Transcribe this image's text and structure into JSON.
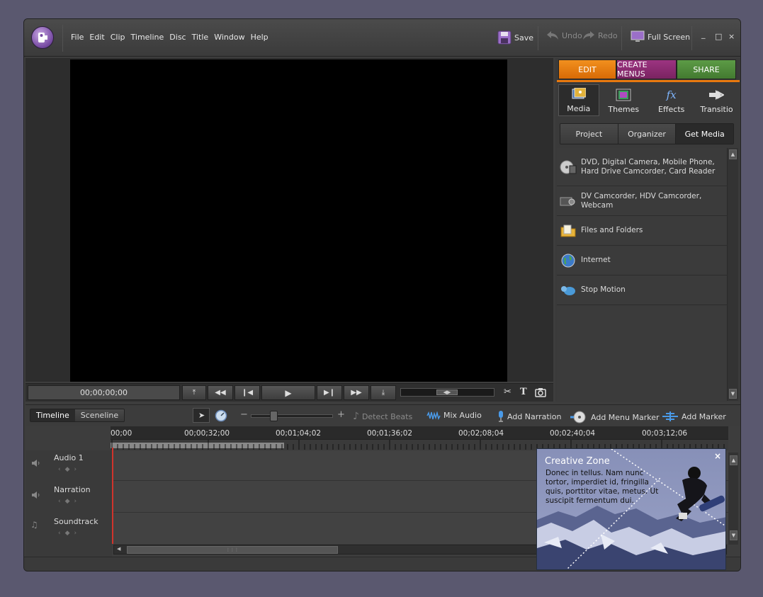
{
  "menu": [
    "File",
    "Edit",
    "Clip",
    "Timeline",
    "Disc",
    "Title",
    "Window",
    "Help"
  ],
  "toolbar": {
    "save": "Save",
    "undo": "Undo",
    "redo": "Redo",
    "fullscreen": "Full Screen"
  },
  "window": {
    "minimize": "_",
    "maximize": "□",
    "close": "×"
  },
  "monitor": {
    "timecode": "00;00;00;00"
  },
  "modes": {
    "edit": "EDIT",
    "create_menus": "CREATE MENUS",
    "share": "SHARE",
    "colors": {
      "edit": "#e8780e",
      "create_menus": "#8a2a6e",
      "share": "#4e8a3a"
    }
  },
  "panel_tabs": [
    "Media",
    "Themes",
    "Effects",
    "Transitio"
  ],
  "source_tabs": [
    "Project",
    "Organizer",
    "Get Media"
  ],
  "get_media_items": [
    {
      "label1": "DVD, Digital Camera, Mobile Phone,",
      "label2": "Hard Drive Camcorder, Card Reader"
    },
    {
      "label1": "DV Camcorder, HDV Camcorder, Webcam",
      "label2": ""
    },
    {
      "label1": "Files and Folders",
      "label2": ""
    },
    {
      "label1": "Internet",
      "label2": ""
    },
    {
      "label1": "Stop Motion",
      "label2": ""
    }
  ],
  "timeline_tabs": [
    "Timeline",
    "Sceneline"
  ],
  "timeline_tools": {
    "zoom_out": "−",
    "zoom_in": "+",
    "detect_beats": "Detect Beats",
    "mix_audio": "Mix Audio",
    "add_narration": "Add Narration",
    "add_menu_marker": "Add Menu Marker",
    "add_marker": "Add Marker"
  },
  "ruler_labels": [
    "00;00",
    "00;00;32;00",
    "00;01;04;02",
    "00;01;36;02",
    "00;02;08;04",
    "00;02;40;04",
    "00;03;12;06"
  ],
  "tracks": [
    "Audio 1",
    "Narration",
    "Soundtrack"
  ],
  "creative_zone": {
    "title": "Creative Zone",
    "body": "Donec in tellus. Nam nunc tortor, imperdiet id, fringilla quis, porttitor vitae, metus. Ut suscipit fermentum dui.",
    "close": "×"
  }
}
